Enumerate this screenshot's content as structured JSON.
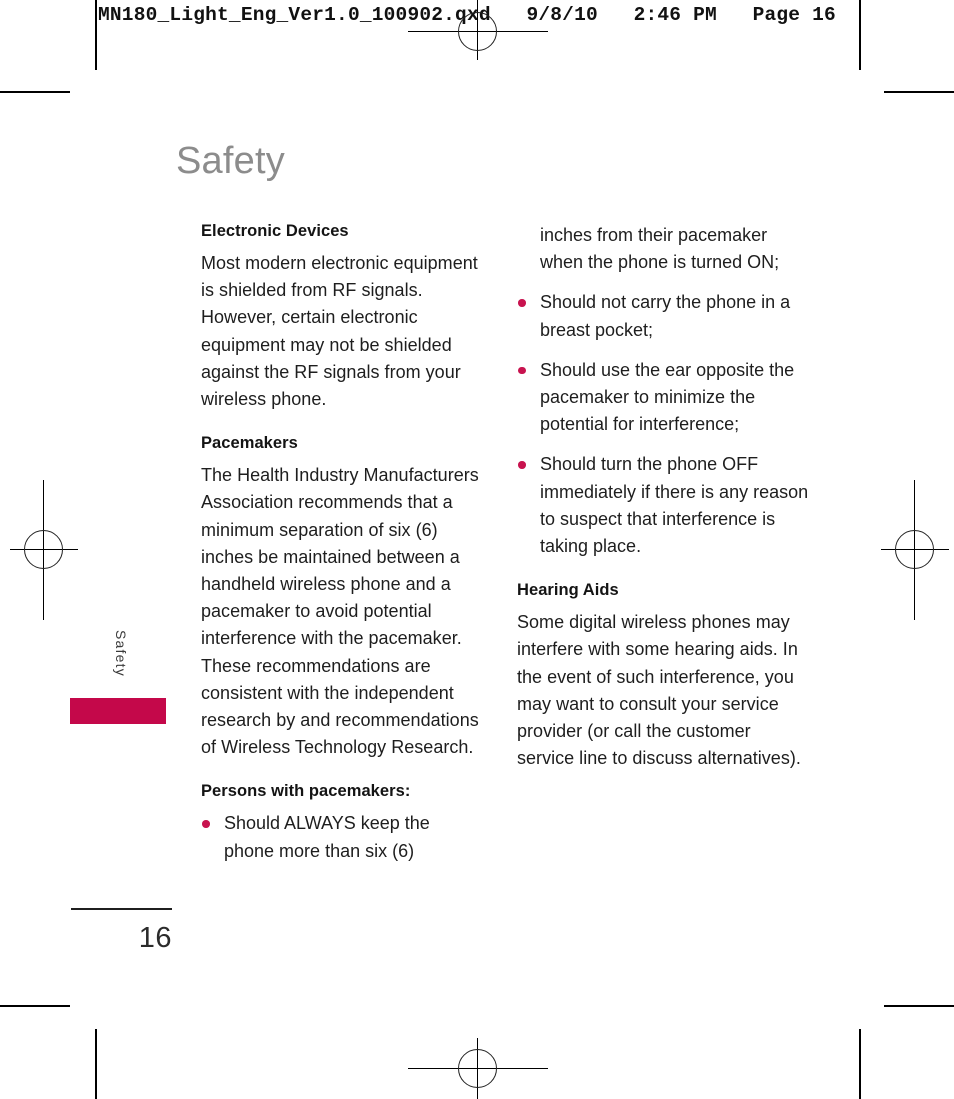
{
  "print_slug": "MN180_Light_Eng_Ver1.0_100902.qxd   9/8/10   2:46 PM   Page 16",
  "page": {
    "title": "Safety",
    "side_tab_label": "Safety",
    "folio": "16",
    "accent_color": "#c4084a",
    "bullet_color": "#c8134f",
    "title_color": "#8c8c8c"
  },
  "columns": {
    "left": {
      "sections": [
        {
          "heading": "Electronic Devices",
          "paragraph": "Most modern electronic equipment is shielded from RF signals. However, certain electronic equipment may not be shielded against the RF signals from your wireless phone."
        },
        {
          "heading": "Pacemakers",
          "paragraph": "The Health Industry Manufacturers Association recommends that a minimum separation of six (6) inches be maintained between a handheld wireless phone and a pacemaker to avoid potential interference with the pacemaker. These recommendations are consistent with the independent research by and recommendations of Wireless Technology Research."
        }
      ],
      "list_heading": "Persons with pacemakers:",
      "bullets": [
        "Should ALWAYS keep the phone more than six (6)"
      ]
    },
    "right": {
      "continuation": "inches from their pacemaker when the phone is turned ON;",
      "bullets": [
        "Should not carry the phone in a breast pocket;",
        "Should use the ear opposite the pacemaker to minimize the potential for interference;",
        "Should turn the phone OFF immediately if there is any reason to suspect that interference is taking place."
      ],
      "section": {
        "heading": "Hearing Aids",
        "paragraph": "Some digital wireless phones may interfere with some hearing aids. In the event of such interference, you may want to consult your service provider (or call the customer service line to discuss alternatives)."
      }
    }
  }
}
